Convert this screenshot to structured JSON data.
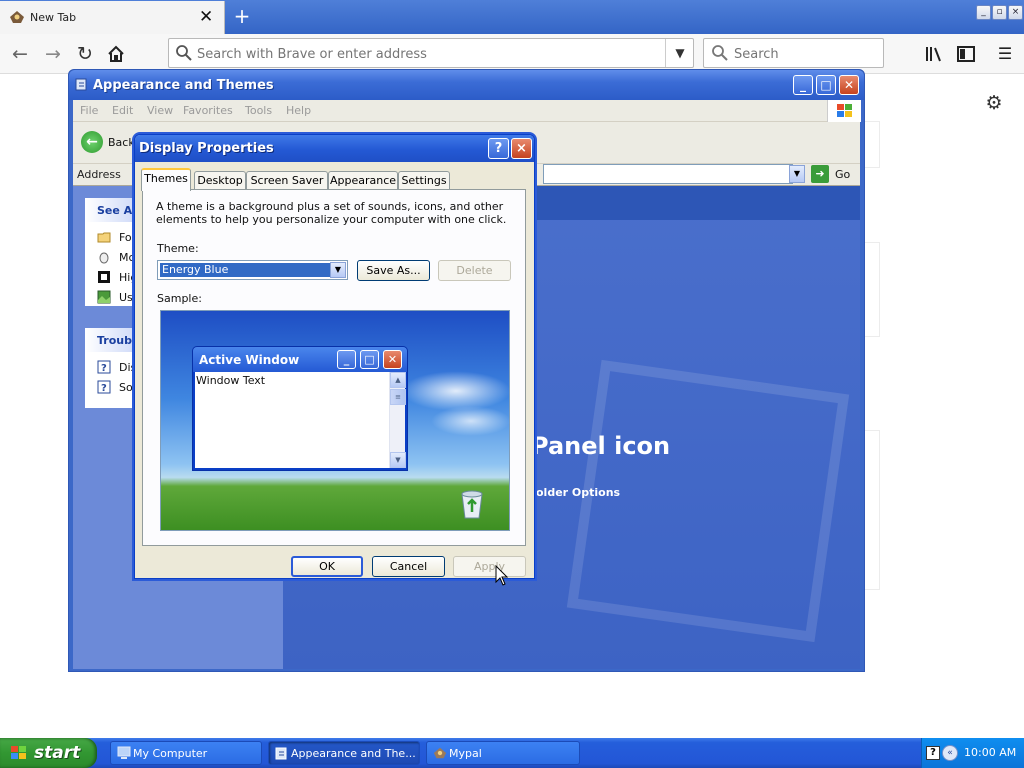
{
  "browser": {
    "tab_title": "New Tab",
    "new_tab_symbol": "+",
    "url_placeholder": "Search with Brave or enter address",
    "search_placeholder": "Search",
    "window_controls": [
      "_",
      "▫",
      "×"
    ]
  },
  "explorer": {
    "title": "Appearance and Themes",
    "menu": [
      "File",
      "Edit",
      "View",
      "Favorites",
      "Tools",
      "Help"
    ],
    "back_label": "Back",
    "address_label": "Address",
    "go_label": "Go",
    "see_also_title": "See Al",
    "see_also_items": [
      "Fo",
      "Mc",
      "Hig",
      "Us"
    ],
    "troubleshooters_title": "Troubl",
    "troubleshooter_items": [
      "Dis",
      "So"
    ],
    "big_text": "Panel icon",
    "sub_text": "older Options"
  },
  "dialog": {
    "title": "Display Properties",
    "help_symbol": "?",
    "close_symbol": "×",
    "tabs": [
      "Themes",
      "Desktop",
      "Screen Saver",
      "Appearance",
      "Settings"
    ],
    "selected_tab": "Themes",
    "description": "A theme is a background plus a set of sounds, icons, and other elements to help you personalize your computer with one click.",
    "theme_label": "Theme:",
    "theme_value": "Energy Blue",
    "save_as_label": "Save As...",
    "delete_label": "Delete",
    "sample_label": "Sample:",
    "sample_window_title": "Active Window",
    "sample_window_text": "Window Text",
    "ok_label": "OK",
    "cancel_label": "Cancel",
    "apply_label": "Apply"
  },
  "taskbar": {
    "start_label": "start",
    "items": [
      "My Computer",
      "Appearance and The...",
      "Mypal"
    ],
    "clock": "10:00 AM"
  },
  "colors": {
    "xp_title_blue": "#2459d4",
    "taskbar_blue": "#245edb",
    "start_green": "#329732",
    "selection_blue": "#316ac5"
  },
  "icons": [
    "back-arrow-icon",
    "forward-arrow-icon",
    "reload-icon",
    "home-icon",
    "search-icon",
    "library-icon",
    "sidebar-icon",
    "hamburger-menu-icon",
    "gear-icon",
    "windows-flag-icon",
    "recycle-bin-icon",
    "mouse-cursor-icon"
  ]
}
